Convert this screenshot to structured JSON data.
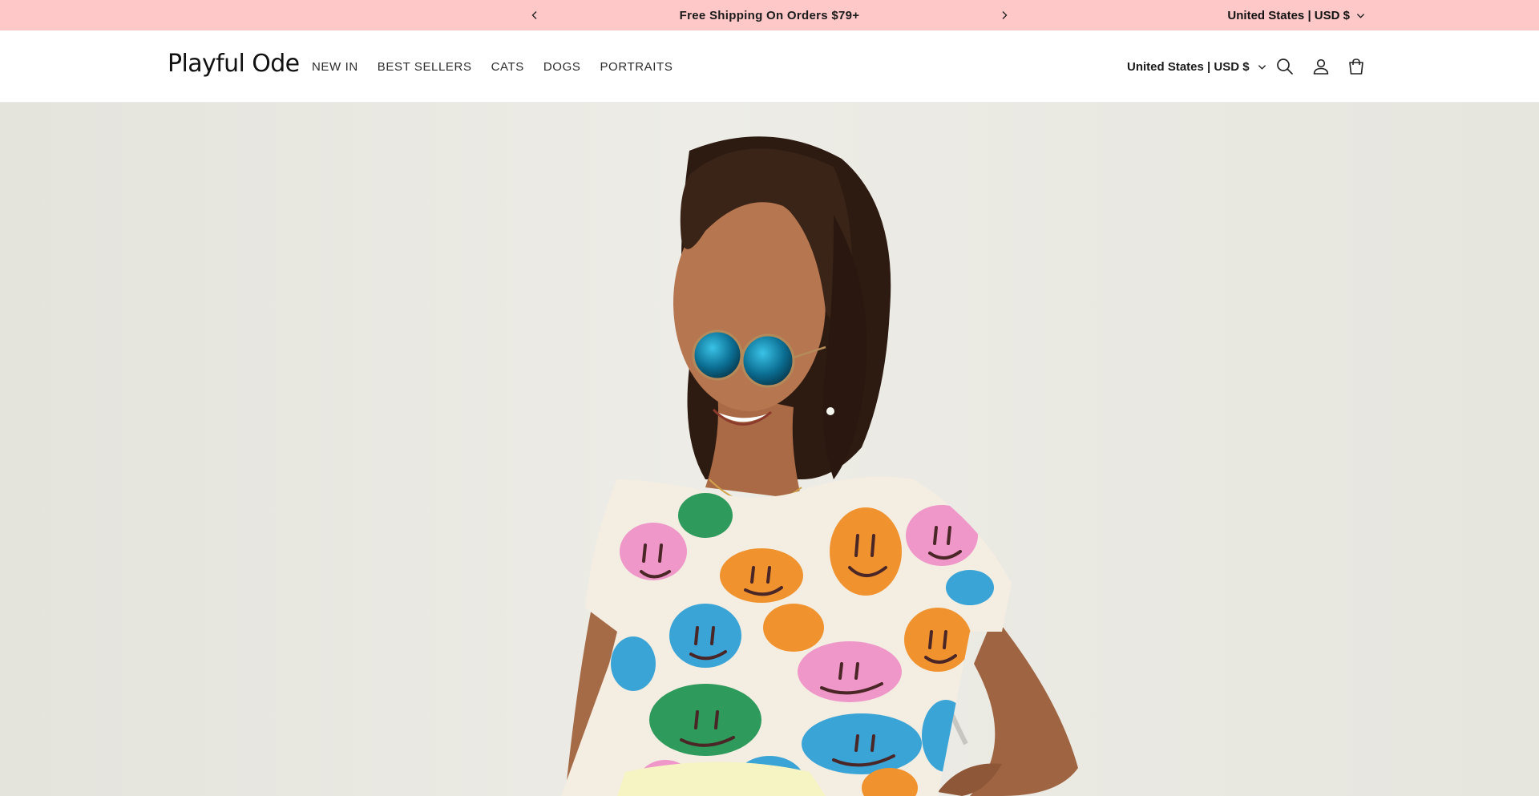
{
  "announcement": {
    "message": "Free Shipping On Orders $79+",
    "prev_icon": "chevron-left-icon",
    "next_icon": "chevron-right-icon",
    "locale": "United States | USD $",
    "background": "#ffc8c8"
  },
  "header": {
    "logo": "Playful Ode",
    "nav": [
      "NEW IN",
      "BEST SELLERS",
      "CATS",
      "DOGS",
      "PORTRAITS"
    ],
    "locale": "United States | USD $",
    "icons": [
      "search-icon",
      "account-icon",
      "cart-icon"
    ]
  },
  "hero": {
    "image": "woman-in-smiley-print-tee-photo"
  }
}
